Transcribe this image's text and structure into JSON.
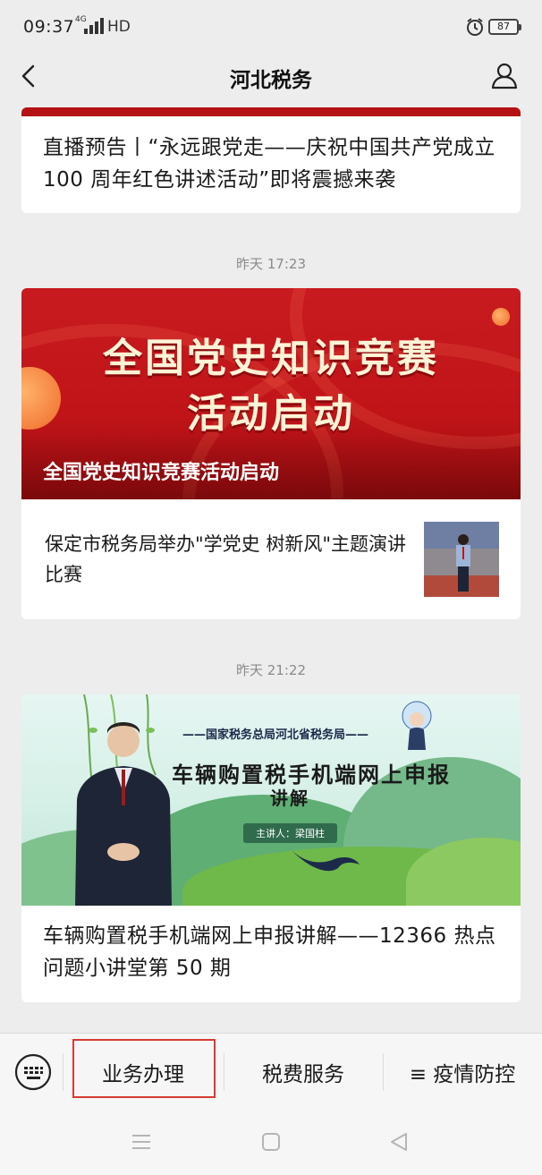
{
  "status_bar": {
    "time": "09:37",
    "network_tag": "4G",
    "hd": "HD",
    "battery": "87"
  },
  "nav": {
    "title": "河北税务"
  },
  "article1": {
    "title": "直播预告丨“永远跟党走——庆祝中国共产党成立 100 周年红色讲述活动”即将震撼来袭"
  },
  "group2": {
    "timestamp": "昨天 17:23",
    "banner_line1": "全国党史知识竞赛",
    "banner_line2": "活动启动",
    "banner_caption": "全国党史知识竞赛活动启动",
    "sub_title": "保定市税务局举办\"学党史 树新风\"主题演讲比赛"
  },
  "group3": {
    "timestamp": "昨天 21:22",
    "banner_org": "——国家税务总局河北省税务局——",
    "banner_title_line1": "车辆购置税手机端网上申报",
    "banner_title_line2": "讲解",
    "banner_speaker": "主讲人：梁国柱",
    "title": "车辆购置税手机端网上申报讲解——12366 热点问题小讲堂第 50 期"
  },
  "bottom_menu": {
    "items": [
      {
        "label": "业务办理"
      },
      {
        "label": "税费服务"
      },
      {
        "label": "≡ 疫情防控"
      }
    ]
  },
  "colors": {
    "brand_red": "#b41215",
    "highlight": "#d83a32",
    "background": "#ededed"
  },
  "icons": [
    "back-arrow-icon",
    "profile-icon",
    "keyboard-icon",
    "alarm-icon",
    "signal-icon",
    "menu-icon",
    "home-icon",
    "back-icon"
  ]
}
